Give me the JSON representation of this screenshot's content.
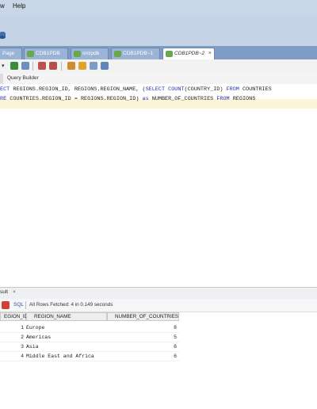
{
  "menubar": {
    "items": [
      "w",
      "Help"
    ]
  },
  "tabs": [
    {
      "label": "Page"
    },
    {
      "label": "CDB1PDB"
    },
    {
      "label": "orclpdb"
    },
    {
      "label": "CDB1PDB~1"
    },
    {
      "label": "CDB1PDB~2",
      "active": true
    }
  ],
  "editor": {
    "subtab_label": "Query Builder",
    "lines": [
      {
        "parts": [
          {
            "t": "ECT ",
            "k": true
          },
          {
            "t": "REGIONS.REGION_ID, REGIONS.REGION_NAME, ("
          },
          {
            "t": "SELECT COUNT",
            "k": true
          },
          {
            "t": "(COUNTRY_ID) "
          },
          {
            "t": "FROM",
            "k": true
          },
          {
            "t": " COUNTRIES"
          }
        ]
      },
      {
        "parts": [
          {
            "t": "RE ",
            "k": true
          },
          {
            "t": "COUNTRIES.REGION_ID = REGIONS.REGION_ID) "
          },
          {
            "t": "as",
            "k": true
          },
          {
            "t": " NUMBER_OF_COUNTRIES "
          },
          {
            "t": "FROM",
            "k": true
          },
          {
            "t": " REGIONS"
          }
        ]
      }
    ]
  },
  "results": {
    "tab_label": "sult",
    "tab_close": "×",
    "sql_label": "SQL",
    "status": "All Rows Fetched: 4 in 0.149 seconds",
    "columns": [
      "EGION_ID",
      "REGION_NAME",
      "NUMBER_OF_COUNTRIES"
    ],
    "rows": [
      {
        "region_id": "1",
        "region_name": "Europe",
        "count": "8"
      },
      {
        "region_id": "2",
        "region_name": "Americas",
        "count": "5"
      },
      {
        "region_id": "3",
        "region_name": "Asia",
        "count": "6"
      },
      {
        "region_id": "4",
        "region_name": "Middle East and Africa",
        "count": "6"
      }
    ]
  },
  "colors": {
    "menubar": "#c9d6e6",
    "tabstrip": "#7e9cc4",
    "keyword": "#1f2fb5",
    "current_line": "#fdf5d8"
  }
}
